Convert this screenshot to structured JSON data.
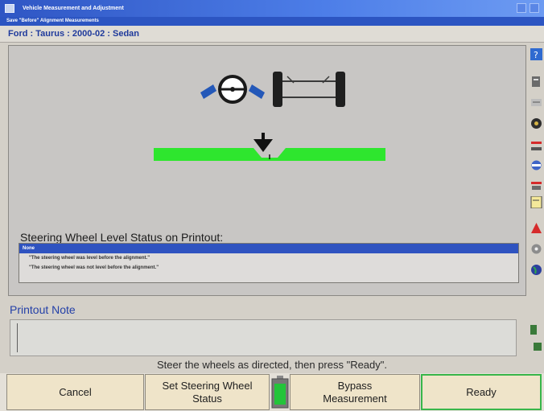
{
  "window": {
    "title": "Vehicle Measurement and Adjustment",
    "subtitle": "Save \"Before\" Alignment Measurements"
  },
  "vehicle": {
    "text": "Ford : Taurus : 2000-02 : Sedan"
  },
  "steering_status": {
    "label": "Steering Wheel Level Status on Printout:",
    "options": [
      "None",
      "\"The steering wheel was level before the alignment.\"",
      "\"The steering wheel was not level before the alignment.\""
    ],
    "selected": "None"
  },
  "printout_note": {
    "label": "Printout Note",
    "value": ""
  },
  "instruction": "Steer the wheels as directed, then press \"Ready\".",
  "buttons": {
    "cancel": "Cancel",
    "set_steering": "Set Steering Wheel Status",
    "bypass": "Bypass Measurement",
    "ready": "Ready"
  },
  "icons": {
    "sidebar": [
      "help-icon",
      "adjust-icon",
      "specs-icon",
      "wheel-icon",
      "runout-icon",
      "alignment-icon",
      "vehicle-icon",
      "warning-icon",
      "tools-icon",
      "globe-icon"
    ],
    "status_indicator": "battery-icon"
  },
  "colors": {
    "title_bar": "#2f56c4",
    "level_bar": "#2ee62e",
    "ready_border": "#38b64a",
    "selection": "#2f53c0"
  }
}
